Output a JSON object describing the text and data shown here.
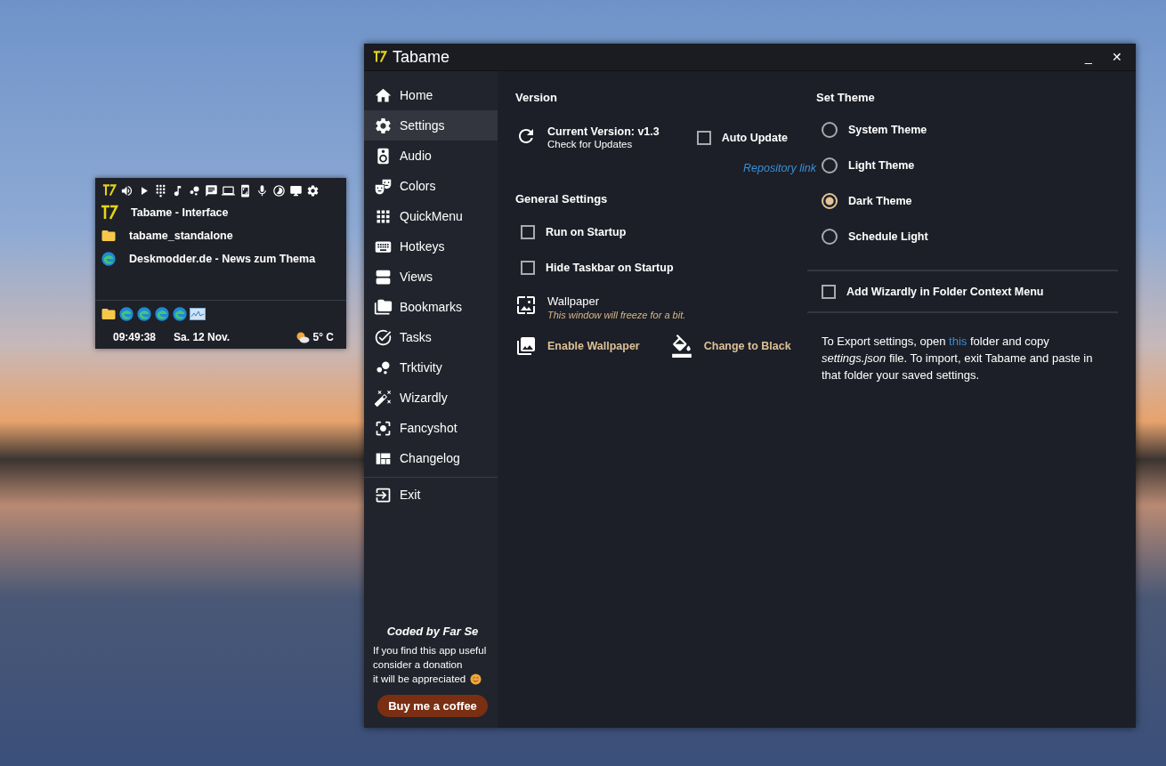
{
  "widget": {
    "items": [
      {
        "kind": "app",
        "title": "Tabame - Interface"
      },
      {
        "kind": "folder",
        "title": "tabame_standalone"
      },
      {
        "kind": "browser",
        "title": "Deskmodder.de - News zum Thema"
      }
    ],
    "time": "09:49:38",
    "date": "Sa. 12 Nov.",
    "weather": "5° C"
  },
  "window": {
    "title": "Tabame",
    "minimize": "_",
    "close": "✕"
  },
  "sidebar": {
    "items": [
      {
        "label": "Home",
        "selected": false
      },
      {
        "label": "Settings",
        "selected": true
      },
      {
        "label": "Audio",
        "selected": false
      },
      {
        "label": "Colors",
        "selected": false
      },
      {
        "label": "QuickMenu",
        "selected": false
      },
      {
        "label": "Hotkeys",
        "selected": false
      },
      {
        "label": "Views",
        "selected": false
      },
      {
        "label": "Bookmarks",
        "selected": false
      },
      {
        "label": "Tasks",
        "selected": false
      },
      {
        "label": "Trktivity",
        "selected": false
      },
      {
        "label": "Wizardly",
        "selected": false
      },
      {
        "label": "Fancyshot",
        "selected": false
      },
      {
        "label": "Changelog",
        "selected": false
      }
    ],
    "exit": "Exit",
    "credit": "Coded by Far Se",
    "donation_lines": [
      "If you find this app useful",
      "consider a donation",
      "it will be appreciated"
    ],
    "donate_button": "Buy me a coffee"
  },
  "version": {
    "heading": "Version",
    "current": "Current Version: v1.3",
    "check": "Check for Updates",
    "auto_update": {
      "label": "Auto Update",
      "checked": false
    },
    "repo_link": "Repository link"
  },
  "general": {
    "heading": "General Settings",
    "options": [
      {
        "label": "Run on Startup",
        "checked": false
      },
      {
        "label": "Hide Taskbar on Startup",
        "checked": false
      }
    ],
    "wallpaper": "Wallpaper",
    "wallpaper_note": "This window will freeze for a bit.",
    "enable_wallpaper": "Enable Wallpaper",
    "change_black": "Change to Black"
  },
  "theme": {
    "heading": "Set Theme",
    "options": [
      {
        "label": "System Theme",
        "selected": false
      },
      {
        "label": "Light Theme",
        "selected": false
      },
      {
        "label": "Dark Theme",
        "selected": true
      },
      {
        "label": "Schedule Light",
        "selected": false
      }
    ]
  },
  "context_menu": {
    "label": "Add Wizardly in Folder Context Menu",
    "checked": false
  },
  "export_note": {
    "before": "To Export settings, open ",
    "link": "this",
    "after": " folder and copy *settings.json* file. To import, exit Tabame and paste in that folder your saved settings."
  }
}
